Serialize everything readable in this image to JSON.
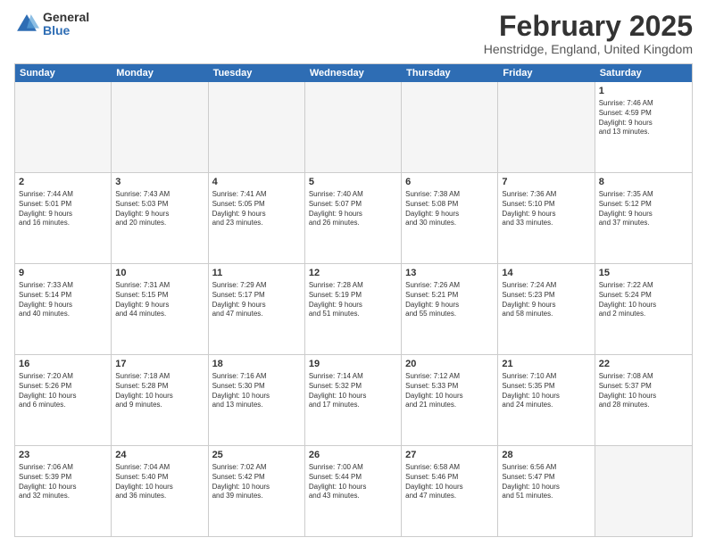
{
  "logo": {
    "general": "General",
    "blue": "Blue"
  },
  "header": {
    "month": "February 2025",
    "location": "Henstridge, England, United Kingdom"
  },
  "weekdays": [
    "Sunday",
    "Monday",
    "Tuesday",
    "Wednesday",
    "Thursday",
    "Friday",
    "Saturday"
  ],
  "rows": [
    {
      "cells": [
        {
          "day": "",
          "empty": true
        },
        {
          "day": "",
          "empty": true
        },
        {
          "day": "",
          "empty": true
        },
        {
          "day": "",
          "empty": true
        },
        {
          "day": "",
          "empty": true
        },
        {
          "day": "",
          "empty": true
        },
        {
          "day": "1",
          "info": "Sunrise: 7:46 AM\nSunset: 4:59 PM\nDaylight: 9 hours\nand 13 minutes."
        }
      ]
    },
    {
      "cells": [
        {
          "day": "2",
          "info": "Sunrise: 7:44 AM\nSunset: 5:01 PM\nDaylight: 9 hours\nand 16 minutes."
        },
        {
          "day": "3",
          "info": "Sunrise: 7:43 AM\nSunset: 5:03 PM\nDaylight: 9 hours\nand 20 minutes."
        },
        {
          "day": "4",
          "info": "Sunrise: 7:41 AM\nSunset: 5:05 PM\nDaylight: 9 hours\nand 23 minutes."
        },
        {
          "day": "5",
          "info": "Sunrise: 7:40 AM\nSunset: 5:07 PM\nDaylight: 9 hours\nand 26 minutes."
        },
        {
          "day": "6",
          "info": "Sunrise: 7:38 AM\nSunset: 5:08 PM\nDaylight: 9 hours\nand 30 minutes."
        },
        {
          "day": "7",
          "info": "Sunrise: 7:36 AM\nSunset: 5:10 PM\nDaylight: 9 hours\nand 33 minutes."
        },
        {
          "day": "8",
          "info": "Sunrise: 7:35 AM\nSunset: 5:12 PM\nDaylight: 9 hours\nand 37 minutes."
        }
      ]
    },
    {
      "cells": [
        {
          "day": "9",
          "info": "Sunrise: 7:33 AM\nSunset: 5:14 PM\nDaylight: 9 hours\nand 40 minutes."
        },
        {
          "day": "10",
          "info": "Sunrise: 7:31 AM\nSunset: 5:15 PM\nDaylight: 9 hours\nand 44 minutes."
        },
        {
          "day": "11",
          "info": "Sunrise: 7:29 AM\nSunset: 5:17 PM\nDaylight: 9 hours\nand 47 minutes."
        },
        {
          "day": "12",
          "info": "Sunrise: 7:28 AM\nSunset: 5:19 PM\nDaylight: 9 hours\nand 51 minutes."
        },
        {
          "day": "13",
          "info": "Sunrise: 7:26 AM\nSunset: 5:21 PM\nDaylight: 9 hours\nand 55 minutes."
        },
        {
          "day": "14",
          "info": "Sunrise: 7:24 AM\nSunset: 5:23 PM\nDaylight: 9 hours\nand 58 minutes."
        },
        {
          "day": "15",
          "info": "Sunrise: 7:22 AM\nSunset: 5:24 PM\nDaylight: 10 hours\nand 2 minutes."
        }
      ]
    },
    {
      "cells": [
        {
          "day": "16",
          "info": "Sunrise: 7:20 AM\nSunset: 5:26 PM\nDaylight: 10 hours\nand 6 minutes."
        },
        {
          "day": "17",
          "info": "Sunrise: 7:18 AM\nSunset: 5:28 PM\nDaylight: 10 hours\nand 9 minutes."
        },
        {
          "day": "18",
          "info": "Sunrise: 7:16 AM\nSunset: 5:30 PM\nDaylight: 10 hours\nand 13 minutes."
        },
        {
          "day": "19",
          "info": "Sunrise: 7:14 AM\nSunset: 5:32 PM\nDaylight: 10 hours\nand 17 minutes."
        },
        {
          "day": "20",
          "info": "Sunrise: 7:12 AM\nSunset: 5:33 PM\nDaylight: 10 hours\nand 21 minutes."
        },
        {
          "day": "21",
          "info": "Sunrise: 7:10 AM\nSunset: 5:35 PM\nDaylight: 10 hours\nand 24 minutes."
        },
        {
          "day": "22",
          "info": "Sunrise: 7:08 AM\nSunset: 5:37 PM\nDaylight: 10 hours\nand 28 minutes."
        }
      ]
    },
    {
      "cells": [
        {
          "day": "23",
          "info": "Sunrise: 7:06 AM\nSunset: 5:39 PM\nDaylight: 10 hours\nand 32 minutes."
        },
        {
          "day": "24",
          "info": "Sunrise: 7:04 AM\nSunset: 5:40 PM\nDaylight: 10 hours\nand 36 minutes."
        },
        {
          "day": "25",
          "info": "Sunrise: 7:02 AM\nSunset: 5:42 PM\nDaylight: 10 hours\nand 39 minutes."
        },
        {
          "day": "26",
          "info": "Sunrise: 7:00 AM\nSunset: 5:44 PM\nDaylight: 10 hours\nand 43 minutes."
        },
        {
          "day": "27",
          "info": "Sunrise: 6:58 AM\nSunset: 5:46 PM\nDaylight: 10 hours\nand 47 minutes."
        },
        {
          "day": "28",
          "info": "Sunrise: 6:56 AM\nSunset: 5:47 PM\nDaylight: 10 hours\nand 51 minutes."
        },
        {
          "day": "",
          "empty": true
        }
      ]
    }
  ]
}
